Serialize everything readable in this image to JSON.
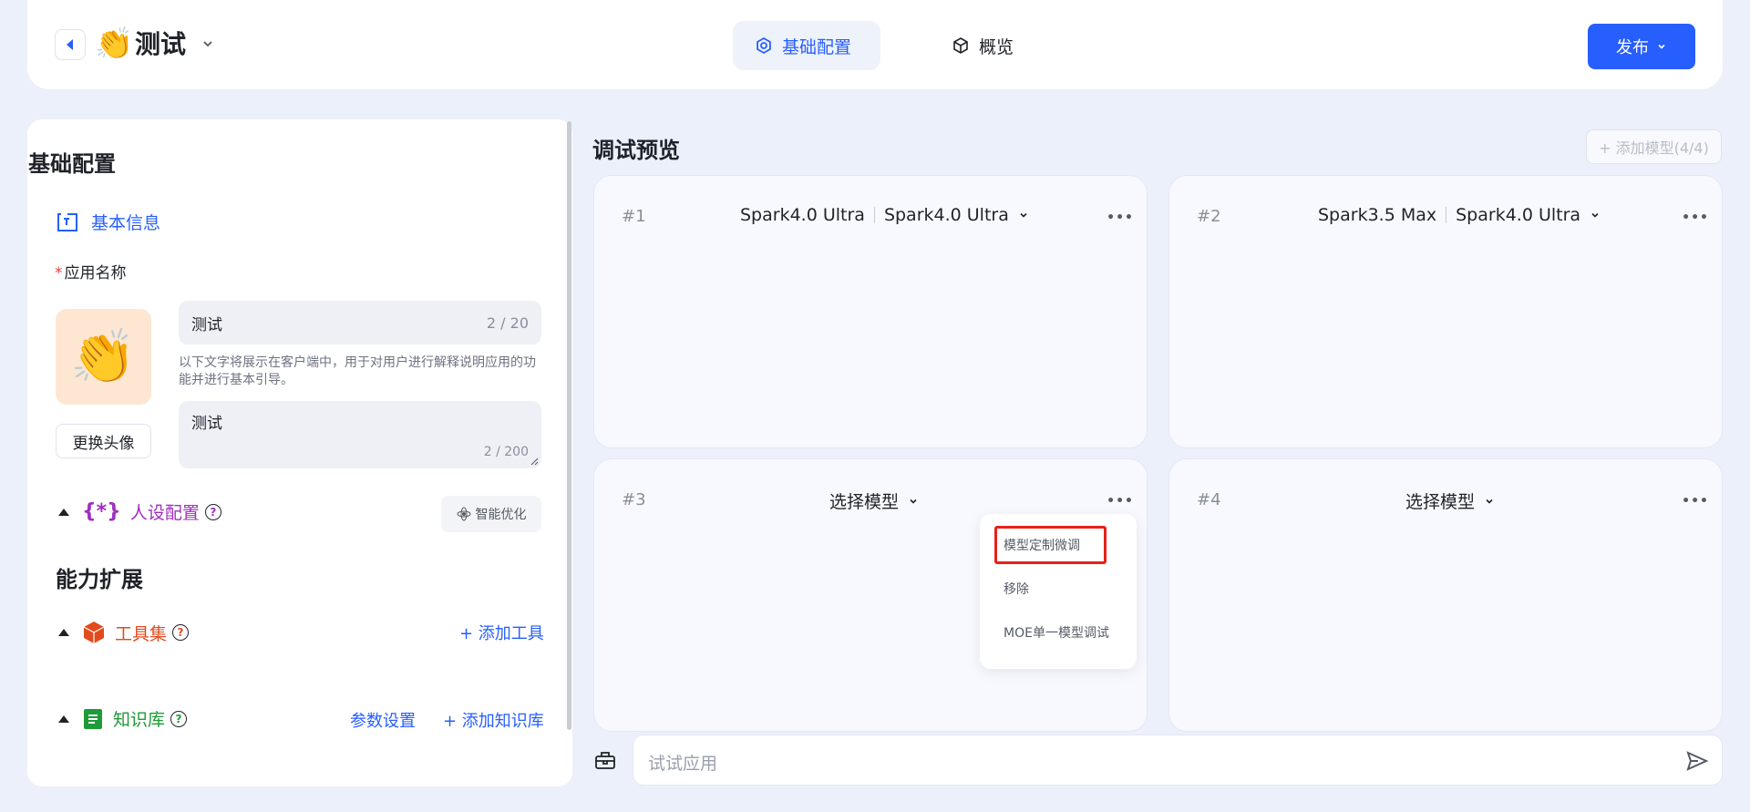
{
  "header": {
    "app_emoji": "👏",
    "app_title": "测试",
    "tabs": [
      {
        "label": "基础配置"
      },
      {
        "label": "概览"
      }
    ],
    "publish_label": "发布"
  },
  "left": {
    "section_title": "基础配置",
    "basic_info_label": "基本信息",
    "app_name_label": "应用名称",
    "avatar_emoji": "👏",
    "change_avatar_label": "更换头像",
    "name_value": "测试",
    "name_count": "2 / 20",
    "helper_text": "以下文字将展示在客户端中，用于对用户进行解释说明应用的功能并进行基本引导。",
    "desc_value": "测试",
    "desc_count": "2 / 200",
    "persona_label": "人设配置",
    "smart_opt_label": "智能优化",
    "ability_title": "能力扩展",
    "toolset_label": "工具集",
    "add_tool_label": "+ 添加工具",
    "knowledge_label": "知识库",
    "param_settings_label": "参数设置",
    "add_knowledge_label": "+ 添加知识库"
  },
  "right": {
    "title": "调试预览",
    "add_model_label": "+ 添加模型(4/4)",
    "cards": [
      {
        "num": "#1",
        "model_a": "Spark4.0 Ultra",
        "model_b": "Spark4.0 Ultra"
      },
      {
        "num": "#2",
        "model_a": "Spark3.5 Max",
        "model_b": "Spark4.0 Ultra"
      },
      {
        "num": "#3",
        "model_a": "选择模型"
      },
      {
        "num": "#4",
        "model_a": "选择模型"
      }
    ],
    "more_label": "•••",
    "menu_items": [
      "模型定制微调",
      "移除",
      "MOE单一模型调试"
    ],
    "chat_placeholder": "试试应用"
  }
}
